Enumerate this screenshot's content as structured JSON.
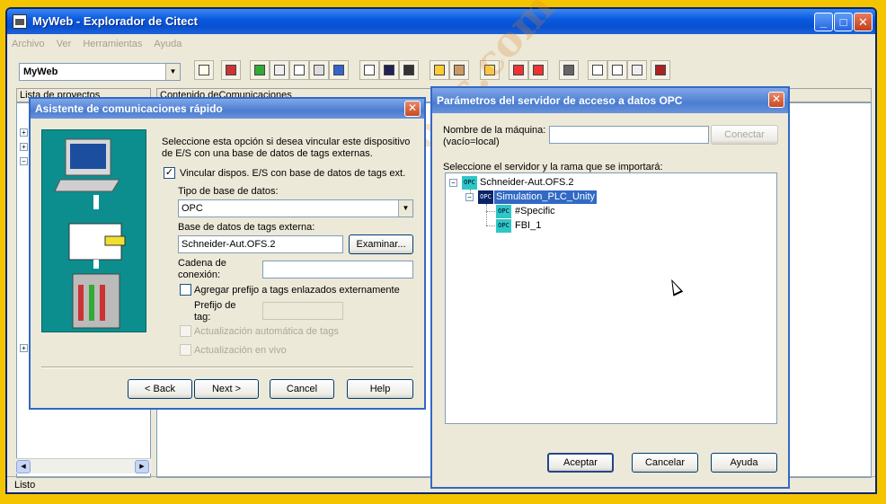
{
  "main_window": {
    "title": "MyWeb - Explorador de Citect",
    "controls": {
      "minimize": "_",
      "maximize": "□",
      "close": "✕"
    },
    "menu": [
      "Archivo",
      "Ver",
      "Herramientas",
      "Ayuda"
    ],
    "project_selector": "MyWeb",
    "left_header": "Lista de proyectos",
    "right_header": "Contenido deComunicaciones",
    "status": "Listo"
  },
  "wizard": {
    "title": "Asistente de comunicaciones rápido",
    "description": "Seleccione esta opción si desea vincular este dispositivo de E/S con una base de datos de tags externas.",
    "link_checkbox": {
      "label": "Vincular dispos.  E/S con base de datos de tags ext.",
      "checked": true
    },
    "db_type_label": "Tipo de base de datos:",
    "db_type_value": "OPC",
    "ext_db_label": "Base de datos de tags externa:",
    "ext_db_value": "Schneider-Aut.OFS.2",
    "browse_button": "Examinar...",
    "conn_label_1": "Cadena de",
    "conn_label_2": "conexión:",
    "prefix_checkbox": {
      "label": "Agregar prefijo a tags enlazados externamente",
      "checked": false
    },
    "prefix_label_1": "Prefijo de",
    "prefix_label_2": "tag:",
    "auto_update": "Actualización automática de tags",
    "live_update": "Actualización en vivo",
    "buttons": {
      "back": "< Back",
      "next": "Next >",
      "cancel": "Cancel",
      "help": "Help"
    }
  },
  "opc_dialog": {
    "title": "Parámetros del servidor de acceso a datos OPC",
    "machine_label_1": "Nombre de la máquina:",
    "machine_label_2": "(vacío=local)",
    "connect_button": "Conectar",
    "select_label": "Seleccione el servidor y la rama que se importará:",
    "badge_text": "OPC",
    "tree": {
      "root": "Schneider-Aut.OFS.2",
      "child": "Simulation_PLC_Unity",
      "leaves": [
        "#Specific",
        "FBI_1"
      ]
    },
    "buttons": {
      "accept": "Aceptar",
      "cancel": "Cancelar",
      "help": "Ayuda"
    }
  },
  "watermark": "www.ni76pc.com"
}
